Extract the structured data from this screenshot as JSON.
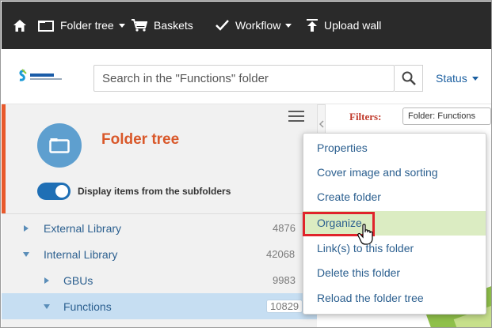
{
  "topnav": {
    "home_icon": "home-icon",
    "items": [
      {
        "label": "Folder tree",
        "icon": "folder-outline-icon",
        "has_caret": true
      },
      {
        "label": "Baskets",
        "icon": "cart-icon",
        "has_caret": false
      },
      {
        "label": "Workflow",
        "icon": "check-icon",
        "has_caret": true
      },
      {
        "label": "Upload wall",
        "icon": "upload-icon",
        "has_caret": false
      }
    ]
  },
  "search": {
    "logo_alt": "SOLVAY",
    "placeholder": "Search in the \"Functions\" folder",
    "status_label": "Status"
  },
  "panel": {
    "title": "Folder tree",
    "toggle_label": "Display items from the subfolders",
    "toggle_on": true
  },
  "tree": [
    {
      "label": "External Library",
      "count": "4876",
      "expanded": false,
      "level": 0
    },
    {
      "label": "Internal Library",
      "count": "42068",
      "expanded": true,
      "level": 0
    },
    {
      "label": "GBUs",
      "count": "9983",
      "expanded": false,
      "level": 1
    },
    {
      "label": "Functions",
      "count": "10829",
      "expanded": true,
      "level": 1,
      "selected": true
    }
  ],
  "filters": {
    "label": "Filters:",
    "chip": "Folder: Functions"
  },
  "menu": {
    "items": [
      {
        "label": "Properties"
      },
      {
        "label": "Cover image and sorting"
      },
      {
        "label": "Create folder"
      },
      {
        "label": "Organize",
        "highlighted": true
      },
      {
        "label": "Link(s) to this folder"
      },
      {
        "label": "Delete this folder"
      },
      {
        "label": "Reload the folder tree"
      }
    ]
  },
  "colors": {
    "nav_bg": "#2a2a2a",
    "accent_orange": "#d9582a",
    "link_blue": "#2b5f8f",
    "highlight_green": "#dbecc2",
    "annotation_red": "#e0242b"
  }
}
